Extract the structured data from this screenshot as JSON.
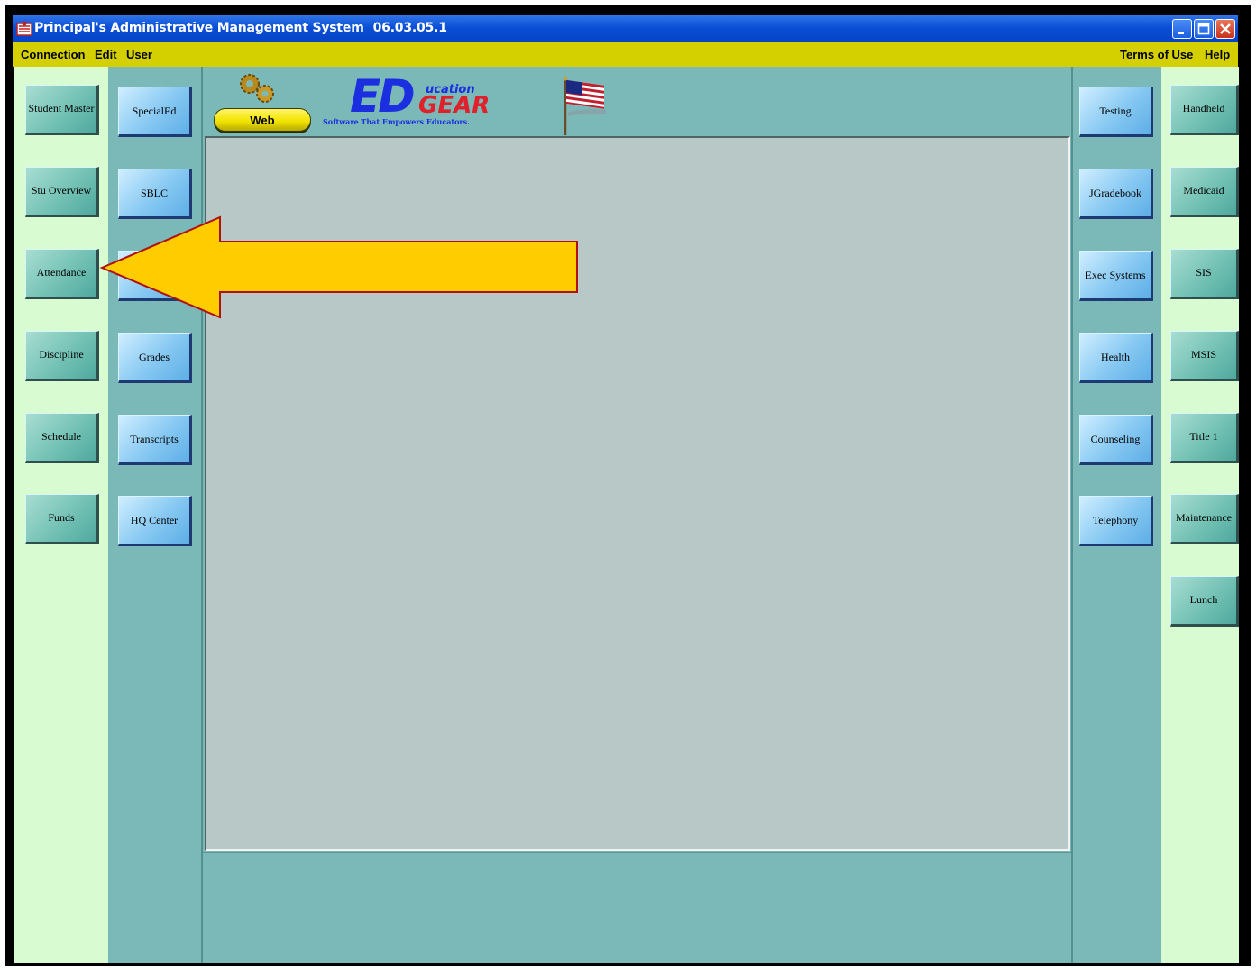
{
  "window": {
    "title": "Principal's Administrative Management System",
    "version": "06.03.05.1"
  },
  "menu": {
    "left": [
      "Connection",
      "Edit",
      "User"
    ],
    "right": [
      "Terms of Use",
      "Help"
    ]
  },
  "header": {
    "web_button": "Web",
    "logo_ed": "ED",
    "logo_ucation": "ucation",
    "logo_gear": "GEAR",
    "logo_tagline": "Software That Empowers Educators."
  },
  "left_column_1": [
    "Student Master",
    "Stu Overview",
    "Attendance",
    "Discipline",
    "Schedule",
    "Funds"
  ],
  "left_column_2": [
    "SpecialEd",
    "SBLC",
    "",
    "Grades",
    "Transcripts",
    "HQ Center"
  ],
  "right_column_1": [
    "Testing",
    "JGradebook",
    "Exec Systems",
    "Health",
    "Counseling",
    "Telephony"
  ],
  "right_column_2": [
    "Handheld",
    "Medicaid",
    "SIS",
    "MSIS",
    "Title 1",
    "Maintenance",
    "Lunch"
  ],
  "colors": {
    "title_bar": "#0a4fd6",
    "menu_bar": "#d4d000",
    "light_column": "#d8fbd2",
    "teal_column": "#7ab9b7",
    "content_panel": "#b8c8c6",
    "arrow_fill": "#ffcc00",
    "arrow_stroke": "#b01010"
  },
  "icons": [
    "app-icon",
    "minimize-icon",
    "maximize-icon",
    "close-icon",
    "gears-icon",
    "us-flag-icon",
    "arrow-pointer"
  ]
}
